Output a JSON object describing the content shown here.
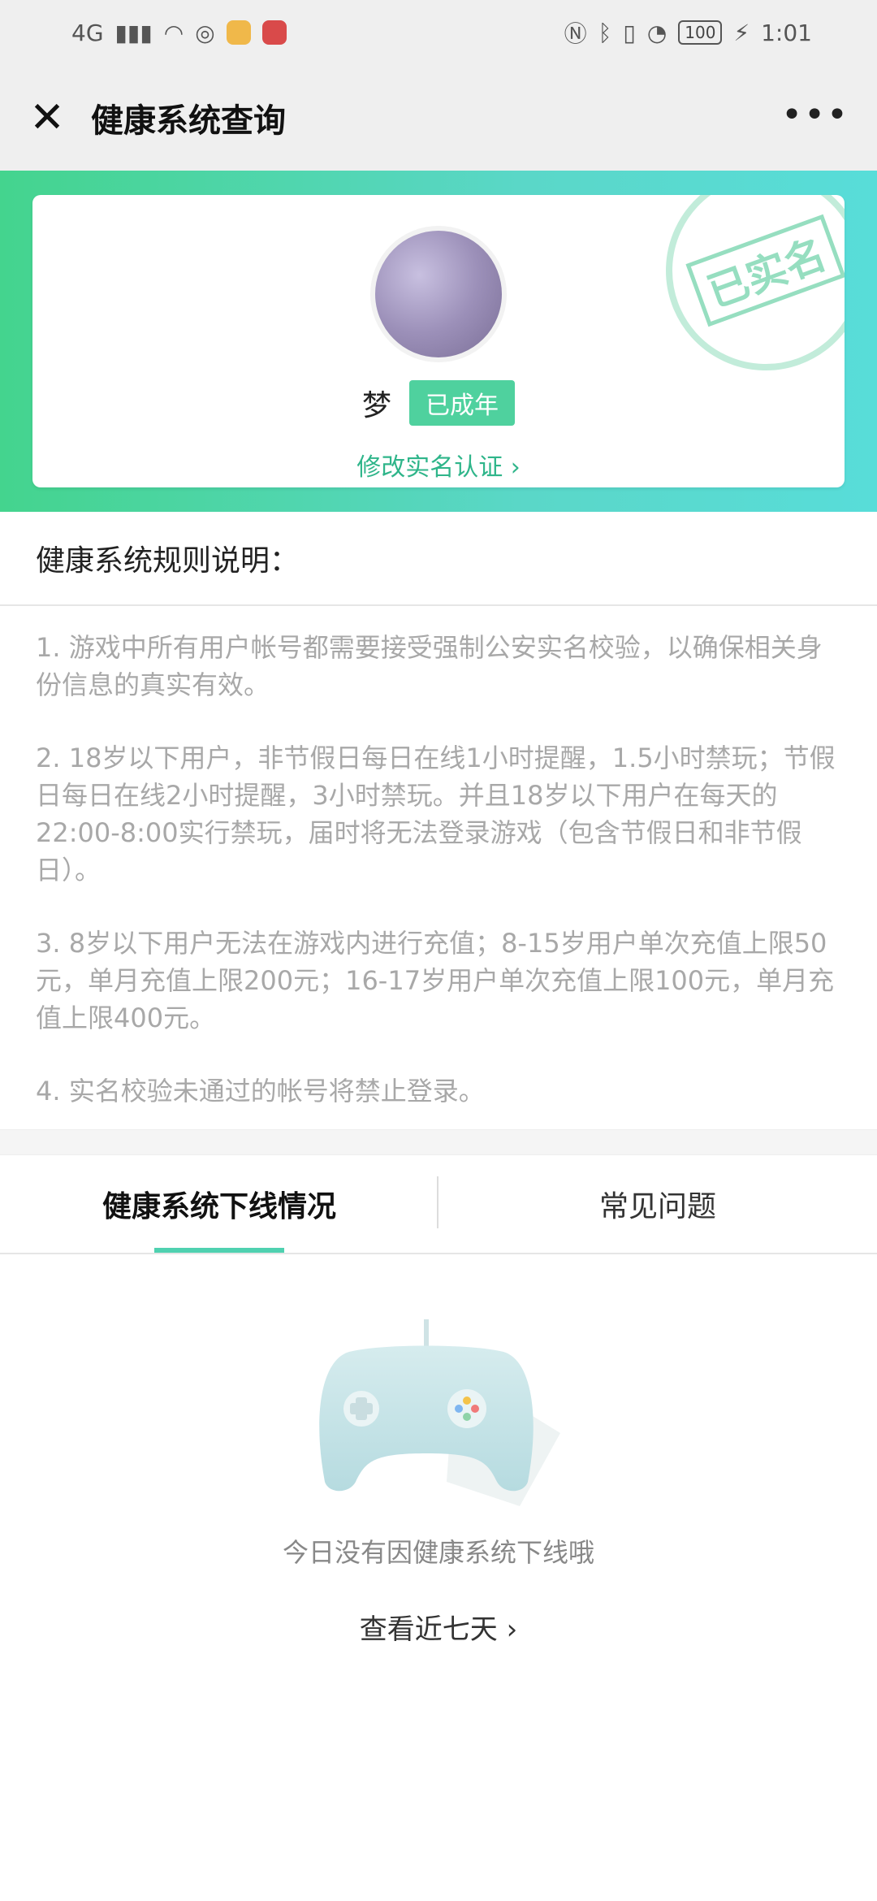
{
  "status_bar": {
    "left_network": "4G",
    "battery": "100",
    "time": "1:01"
  },
  "header": {
    "title": "健康系统查询"
  },
  "profile": {
    "name": "梦",
    "badge": "已成年",
    "edit_link": "修改实名认证 ›",
    "stamp_text": "已实名"
  },
  "rules": {
    "title": "健康系统规则说明：",
    "items": [
      "1. 游戏中所有用户帐号都需要接受强制公安实名校验，以确保相关身份信息的真实有效。",
      "2. 18岁以下用户，非节假日每日在线1小时提醒，1.5小时禁玩；节假日每日在线2小时提醒，3小时禁玩。并且18岁以下用户在每天的22:00-8:00实行禁玩，届时将无法登录游戏（包含节假日和非节假日）。",
      "3. 8岁以下用户无法在游戏内进行充值；8-15岁用户单次充值上限50元，单月充值上限200元；16-17岁用户单次充值上限100元，单月充值上限400元。",
      "4. 实名校验未通过的帐号将禁止登录。"
    ]
  },
  "tabs": [
    {
      "label": "健康系统下线情况"
    },
    {
      "label": "常见问题"
    }
  ],
  "empty_state": {
    "message": "今日没有因健康系统下线哦",
    "link": "查看近七天 ›"
  }
}
